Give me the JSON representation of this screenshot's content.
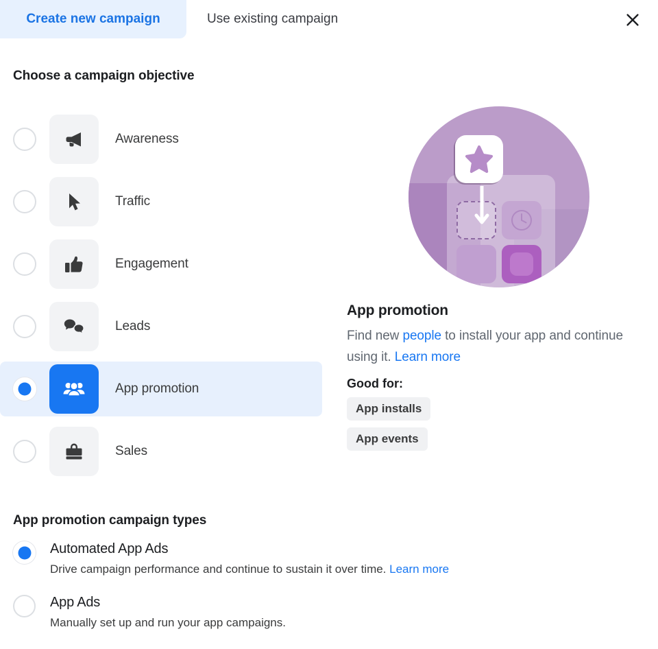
{
  "tabs": [
    {
      "label": "Create new campaign",
      "active": true
    },
    {
      "label": "Use existing campaign",
      "active": false
    }
  ],
  "close_icon": "close-icon",
  "objective_section": {
    "title": "Choose a campaign objective",
    "options": [
      {
        "label": "Awareness",
        "icon": "megaphone-icon",
        "selected": false
      },
      {
        "label": "Traffic",
        "icon": "cursor-arrow-icon",
        "selected": false
      },
      {
        "label": "Engagement",
        "icon": "thumbs-up-icon",
        "selected": false
      },
      {
        "label": "Leads",
        "icon": "speech-bubbles-icon",
        "selected": false
      },
      {
        "label": "App promotion",
        "icon": "people-group-icon",
        "selected": true
      },
      {
        "label": "Sales",
        "icon": "shopping-bag-icon",
        "selected": false
      }
    ]
  },
  "info_panel": {
    "illustration": "app-promotion-illustration",
    "title": "App promotion",
    "description_part1": "Find new ",
    "description_link1": "people",
    "description_part2": " to install your app and continue using it. ",
    "description_link2": "Learn more",
    "good_for_label": "Good for:",
    "chips": [
      "App installs",
      "App events"
    ]
  },
  "types_section": {
    "title": "App promotion campaign types",
    "options": [
      {
        "label": "Automated App Ads",
        "description": "Drive campaign performance and continue to sustain it over time. ",
        "link": "Learn more",
        "selected": true
      },
      {
        "label": "App Ads",
        "description": "Manually set up and run your app campaigns.",
        "link": "",
        "selected": false
      }
    ]
  },
  "colors": {
    "accent": "#1877f2",
    "link": "#1877f2",
    "tab_active_bg": "#e7f1fe",
    "row_selected_bg": "#e7f0fd",
    "tile_bg": "#f2f3f5",
    "chip_bg": "#f0f1f3",
    "text_primary": "#1c1e21",
    "text_secondary": "#606770",
    "illustration_purple": "#bb9cc9"
  }
}
